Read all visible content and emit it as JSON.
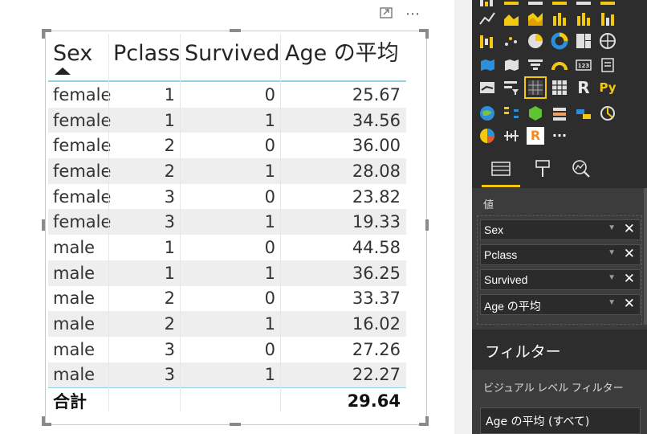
{
  "canvas": {
    "focus_icon": "focus-mode-icon",
    "more_options_label": "⋯"
  },
  "table": {
    "headers": [
      "Sex",
      "Pclass",
      "Survived",
      "Age の平均"
    ],
    "sorted_column": "Sex",
    "sort_direction": "ascending",
    "rows": [
      [
        "female",
        "1",
        "0",
        "25.67"
      ],
      [
        "female",
        "1",
        "1",
        "34.56"
      ],
      [
        "female",
        "2",
        "0",
        "36.00"
      ],
      [
        "female",
        "2",
        "1",
        "28.08"
      ],
      [
        "female",
        "3",
        "0",
        "23.82"
      ],
      [
        "female",
        "3",
        "1",
        "19.33"
      ],
      [
        "male",
        "1",
        "0",
        "44.58"
      ],
      [
        "male",
        "1",
        "1",
        "36.25"
      ],
      [
        "male",
        "2",
        "0",
        "33.37"
      ],
      [
        "male",
        "2",
        "1",
        "16.02"
      ],
      [
        "male",
        "3",
        "0",
        "27.26"
      ],
      [
        "male",
        "3",
        "1",
        "22.27"
      ]
    ],
    "total": {
      "label": "合計",
      "value": "29.64"
    }
  },
  "pane": {
    "gallery_more_label": "···",
    "gallery_text_icons": {
      "r": "R",
      "py": "Py",
      "num": "123"
    },
    "values_title": "値",
    "fields": [
      {
        "name": "Sex"
      },
      {
        "name": "Pclass"
      },
      {
        "name": "Survived"
      },
      {
        "name": "Age の平均"
      }
    ],
    "field_dropdown_glyph": "▼",
    "field_remove_glyph": "✕",
    "filters_title": "フィルター",
    "visual_level_filters_title": "ビジュアル レベル フィルター",
    "filter_card_label": "Age の平均 (すべて)"
  },
  "colors": {
    "accent_yellow": "#f2c811",
    "header_rule": "#8fd3e0",
    "pane_dark": "#2d2d2d",
    "pane_mid": "#3c3c3c"
  }
}
